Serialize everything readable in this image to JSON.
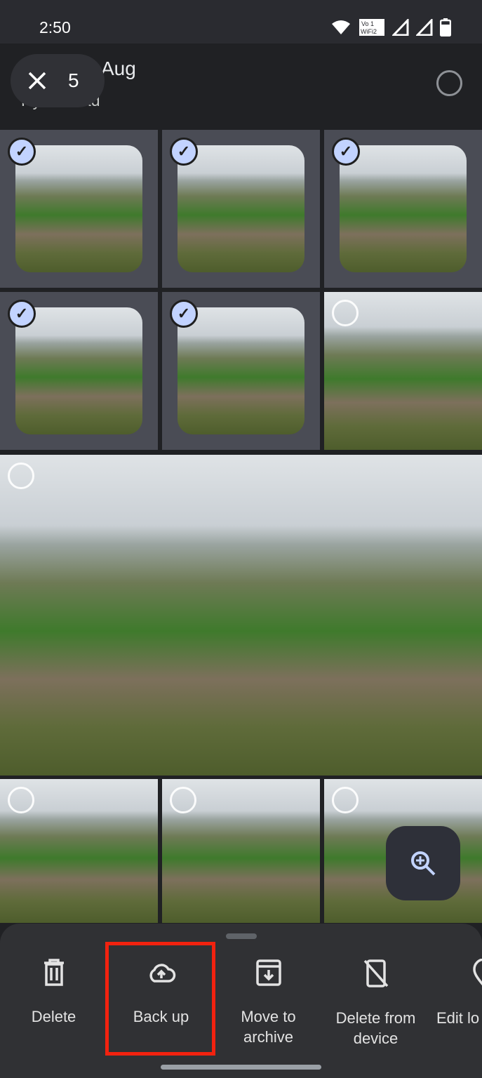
{
  "status_bar": {
    "time": "2:50",
    "icons": [
      "wifi-icon",
      "vowifi-icon",
      "signal-icon",
      "signal-icon",
      "battery-icon"
    ]
  },
  "header": {
    "title": "Aug",
    "subtitle": "Hyderabad",
    "selected_count": "5"
  },
  "grid": {
    "tiles": [
      {
        "selected": true
      },
      {
        "selected": true
      },
      {
        "selected": true
      },
      {
        "selected": true
      },
      {
        "selected": true
      },
      {
        "selected": false
      },
      {
        "selected": false
      },
      {
        "selected": false
      },
      {
        "selected": false
      },
      {
        "selected": false
      }
    ]
  },
  "actions": [
    {
      "label": "Delete",
      "icon": "trash-icon"
    },
    {
      "label": "Back up",
      "icon": "cloud-upload-icon"
    },
    {
      "label": "Move to archive",
      "icon": "archive-icon"
    },
    {
      "label": "Delete from device",
      "icon": "delete-from-device-icon"
    },
    {
      "label": "Edit lo",
      "icon": "location-icon"
    }
  ],
  "colors": {
    "accent": "#c2d3ff",
    "highlight": "#f2220f"
  }
}
